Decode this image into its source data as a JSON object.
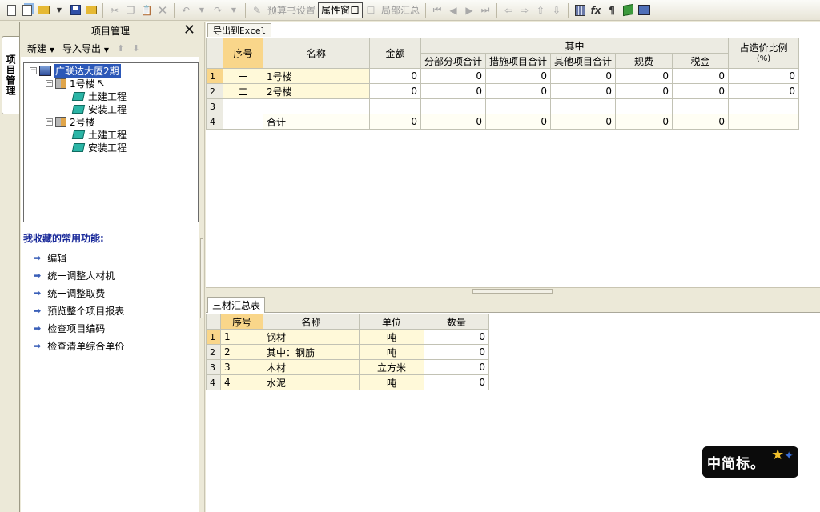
{
  "toolbar": {
    "budget_settings": "预算书设置",
    "property_window": "属性窗口",
    "partial_summary": "局部汇总"
  },
  "left_tab": {
    "label": "项目管理"
  },
  "left_panel": {
    "title": "项目管理",
    "menu_new": "新建",
    "menu_import_export": "导入导出",
    "tree": {
      "root": "广联达大厦2期",
      "building1": "1号楼",
      "b1_civil": "土建工程",
      "b1_install": "安装工程",
      "building2": "2号楼",
      "b2_civil": "土建工程",
      "b2_install": "安装工程"
    },
    "favorites_title": "我收藏的常用功能:",
    "favorites": [
      "编辑",
      "统一调整人材机",
      "统一调整取费",
      "预览整个项目报表",
      "检查项目编码",
      "检查清单综合单价"
    ]
  },
  "top_grid": {
    "export_tab": "导出到Excel",
    "headers": {
      "seq": "序号",
      "name": "名称",
      "amount": "金额",
      "group": "其中",
      "sub1": "分部分项合计",
      "sub2": "措施项目合计",
      "sub3": "其他项目合计",
      "sub4": "规费",
      "sub5": "税金",
      "ratio_line1": "占造价比例",
      "ratio_line2": "(%)"
    },
    "rows": [
      {
        "rn": "1",
        "seq": "一",
        "name": "1号楼",
        "amount": "0",
        "c1": "0",
        "c2": "0",
        "c3": "0",
        "c4": "0",
        "c5": "0",
        "ratio": "0"
      },
      {
        "rn": "2",
        "seq": "二",
        "name": "2号楼",
        "amount": "0",
        "c1": "0",
        "c2": "0",
        "c3": "0",
        "c4": "0",
        "c5": "0",
        "ratio": "0"
      },
      {
        "rn": "3",
        "seq": "",
        "name": "",
        "amount": "",
        "c1": "",
        "c2": "",
        "c3": "",
        "c4": "",
        "c5": "",
        "ratio": ""
      },
      {
        "rn": "4",
        "seq": "",
        "name": "合计",
        "amount": "0",
        "c1": "0",
        "c2": "0",
        "c3": "0",
        "c4": "0",
        "c5": "0",
        "ratio": ""
      }
    ]
  },
  "bottom_grid": {
    "tab": "三材汇总表",
    "headers": {
      "seq": "序号",
      "name": "名称",
      "unit": "单位",
      "qty": "数量"
    },
    "rows": [
      {
        "rn": "1",
        "seq": "1",
        "name": "钢材",
        "unit": "吨",
        "qty": "0"
      },
      {
        "rn": "2",
        "seq": "2",
        "name": "其中：钢筋",
        "unit": "吨",
        "qty": "0"
      },
      {
        "rn": "3",
        "seq": "3",
        "name": "木材",
        "unit": "立方米",
        "qty": "0"
      },
      {
        "rn": "4",
        "seq": "4",
        "name": "水泥",
        "unit": "吨",
        "qty": "0"
      }
    ]
  },
  "watermark": {
    "text": "中简标。"
  }
}
